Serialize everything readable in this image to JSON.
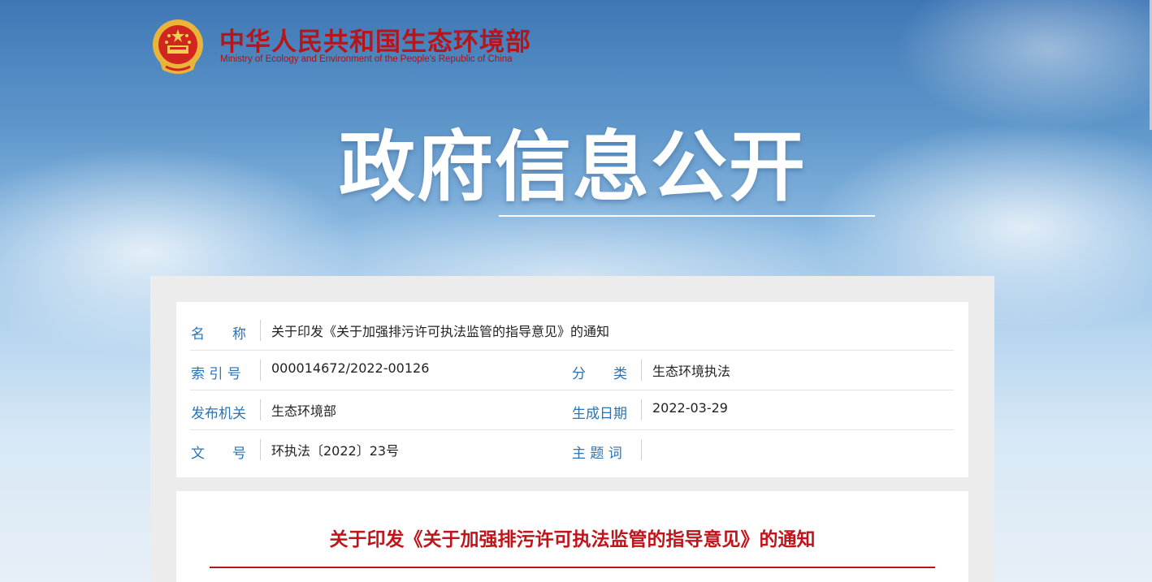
{
  "header": {
    "brand_cn": "中华人民共和国生态环境部",
    "brand_en": "Ministry of Ecology and Environment of the People's Republic of China",
    "banner_title": "政府信息公开",
    "emblem_icon": "national-emblem-icon"
  },
  "info": {
    "name_label": [
      "名",
      "称"
    ],
    "name_value": "关于印发《关于加强排污许可执法监管的指导意见》的通知",
    "index_label": "索 引 号",
    "index_value": "000014672/2022-00126",
    "category_label": [
      "分",
      "类"
    ],
    "category_value": "生态环境执法",
    "issuer_label": "发布机关",
    "issuer_value": "生态环境部",
    "date_label": "生成日期",
    "date_value": "2022-03-29",
    "docno_label": [
      "文",
      "号"
    ],
    "docno_value": "环执法〔2022〕23号",
    "keywords_label": "主 题 词",
    "keywords_value": ""
  },
  "article": {
    "title": "关于印发《关于加强排污许可执法监管的指导意见》的通知"
  },
  "colors": {
    "brand_red": "#b4161c",
    "label_blue": "#2a73b5",
    "title_red": "#c0141b"
  }
}
